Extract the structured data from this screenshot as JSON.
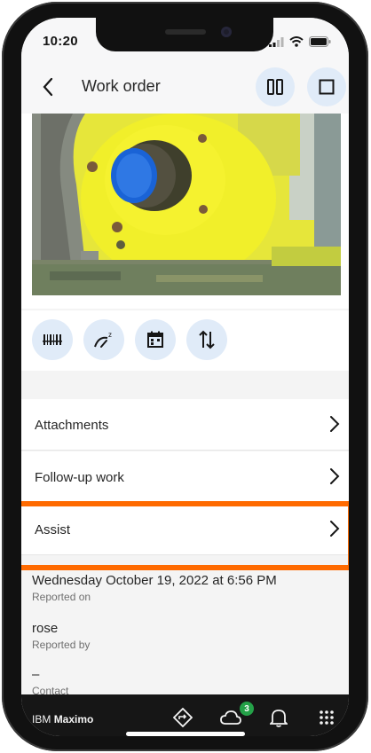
{
  "status_bar": {
    "time": "10:20"
  },
  "header": {
    "title": "Work order"
  },
  "list": [
    {
      "label": "Attachments"
    },
    {
      "label": "Follow-up work"
    },
    {
      "label": "Assist"
    }
  ],
  "details": [
    {
      "value": "Wednesday October 19, 2022  at  6:56 PM",
      "caption": "Reported on"
    },
    {
      "value": "rose",
      "caption": "Reported by"
    },
    {
      "value": "–",
      "caption": "Contact"
    }
  ],
  "footer": {
    "brand_prefix": "IBM",
    "brand_name": "Maximo",
    "notification_count": "3"
  },
  "icons": {
    "back": "chevron-left-icon",
    "split_view": "split-view-icon",
    "full_view": "square-icon",
    "row_buttons": [
      "barcode-icon",
      "meter-icon",
      "calendar-icon",
      "sort-icon"
    ],
    "nav": [
      "map-icon",
      "cloud-sync-icon",
      "bell-icon",
      "app-switcher-icon"
    ]
  },
  "colors": {
    "accent_bg": "#e0ebf8",
    "highlight": "#ff6a00",
    "bottom_bar": "#161616",
    "badge": "#24a148"
  }
}
